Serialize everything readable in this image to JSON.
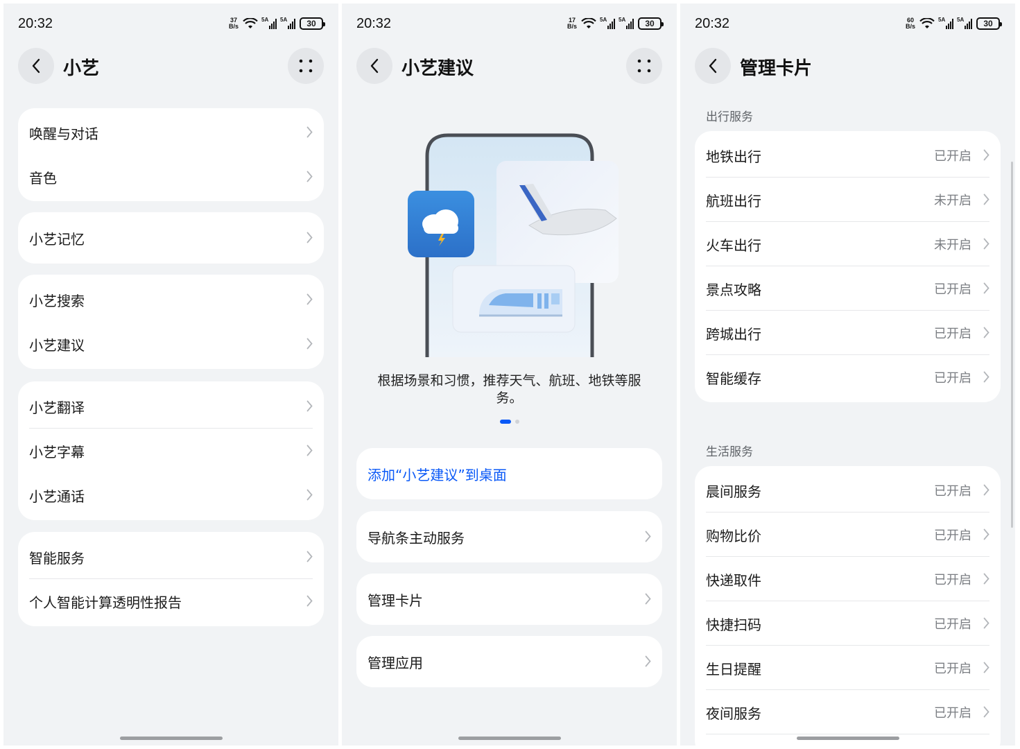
{
  "status": {
    "time": "20:32",
    "battery": "30",
    "signal_label": "5A",
    "p1_speed": "37",
    "p2_speed": "17",
    "p3_speed": "60",
    "speed_unit": "B/s"
  },
  "screen1": {
    "title": "小艺",
    "groups": [
      [
        "唤醒与对话",
        "音色"
      ],
      [
        "小艺记忆"
      ],
      [
        "小艺搜索",
        "小艺建议"
      ],
      [
        "小艺翻译",
        "小艺字幕",
        "小艺通话"
      ],
      [
        "智能服务",
        "个人智能计算透明性报告"
      ]
    ]
  },
  "screen2": {
    "title": "小艺建议",
    "description": "根据场景和习惯，推荐天气、航班、地铁等服务。",
    "pager": {
      "count": 2,
      "active": 1
    },
    "add_link": "添加“小艺建议”到桌面",
    "items": [
      "导航条主动服务",
      "管理卡片",
      "管理应用"
    ]
  },
  "screen3": {
    "title": "管理卡片",
    "sections": [
      {
        "title": "出行服务",
        "items": [
          {
            "label": "地铁出行",
            "state": "已开启"
          },
          {
            "label": "航班出行",
            "state": "未开启"
          },
          {
            "label": "火车出行",
            "state": "未开启"
          },
          {
            "label": "景点攻略",
            "state": "已开启"
          },
          {
            "label": "跨城出行",
            "state": "已开启"
          },
          {
            "label": "智能缓存",
            "state": "已开启"
          }
        ]
      },
      {
        "title": "生活服务",
        "items": [
          {
            "label": "晨间服务",
            "state": "已开启"
          },
          {
            "label": "购物比价",
            "state": "已开启"
          },
          {
            "label": "快递取件",
            "state": "已开启"
          },
          {
            "label": "快捷扫码",
            "state": "已开启"
          },
          {
            "label": "生日提醒",
            "state": "已开启"
          },
          {
            "label": "夜间服务",
            "state": "已开启"
          }
        ]
      }
    ]
  },
  "colors": {
    "accent": "#0a59f7",
    "background": "#f1f3f5",
    "card": "#ffffff",
    "secondary_text": "#7a7d82"
  },
  "icons": [
    "back-arrow-icon",
    "more-dots-icon",
    "chevron-right-icon",
    "wifi-icon",
    "signal-icon",
    "battery-icon",
    "weather-storm-icon",
    "airplane-icon",
    "train-icon"
  ]
}
